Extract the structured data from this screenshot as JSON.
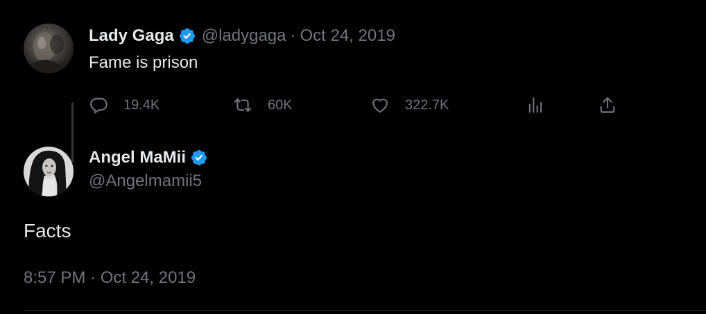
{
  "colors": {
    "background": "#000000",
    "primary_text": "#e7e9ea",
    "secondary_text": "#71767b",
    "verified_badge": "#1d9bf0",
    "thread_line": "#333639"
  },
  "parent_tweet": {
    "author_name": "Lady Gaga",
    "handle": "@ladygaga",
    "separator": "·",
    "date": "Oct 24, 2019",
    "text": "Fame is prison",
    "verified_icon": "verified-badge-icon",
    "avatar_icon": "avatar-lady-gaga",
    "actions": {
      "reply": {
        "icon": "reply-icon",
        "count": "19.4K"
      },
      "retweet": {
        "icon": "retweet-icon",
        "count": "60K"
      },
      "like": {
        "icon": "heart-icon",
        "count": "322.7K"
      },
      "views": {
        "icon": "views-chart-icon"
      },
      "share": {
        "icon": "share-icon"
      }
    }
  },
  "reply_tweet": {
    "author_name": "Angel MaMii",
    "handle": "@Angelmamii5",
    "verified_icon": "verified-badge-icon",
    "avatar_icon": "avatar-angel-mamii",
    "text": "Facts",
    "timestamp": "8:57 PM · Oct 24, 2019"
  }
}
